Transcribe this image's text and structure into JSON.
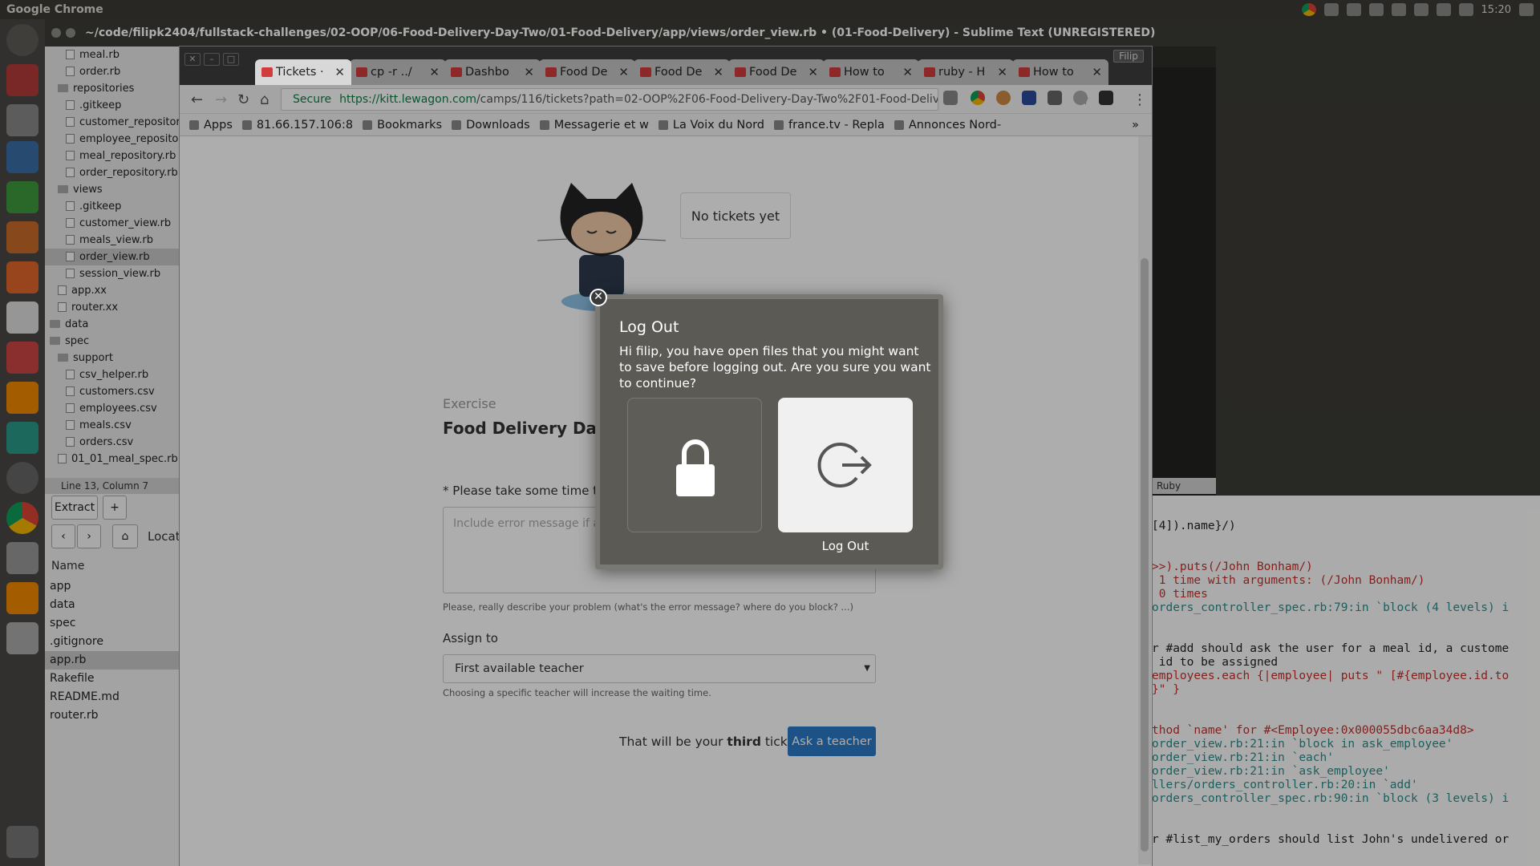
{
  "topbar": {
    "app_name": "Google Chrome",
    "time": "15:20"
  },
  "sublime": {
    "title": "~/code/filipk2404/fullstack-challenges/02-OOP/06-Food-Delivery-Day-Two/01-Food-Delivery/app/views/order_view.rb • (01-Food-Delivery) - Sublime Text (UNREGISTERED)",
    "status": "Line 13, Column 7",
    "right_status": "Ruby",
    "sidebar": [
      {
        "label": "meal.rb",
        "type": "file",
        "indent": 2
      },
      {
        "label": "order.rb",
        "type": "file",
        "indent": 2
      },
      {
        "label": "repositories",
        "type": "folder",
        "indent": 1
      },
      {
        "label": ".gitkeep",
        "type": "file",
        "indent": 2
      },
      {
        "label": "customer_repository.rb",
        "type": "file",
        "indent": 2
      },
      {
        "label": "employee_repository.rb",
        "type": "file",
        "indent": 2
      },
      {
        "label": "meal_repository.rb",
        "type": "file",
        "indent": 2
      },
      {
        "label": "order_repository.rb",
        "type": "file",
        "indent": 2
      },
      {
        "label": "views",
        "type": "folder",
        "indent": 1
      },
      {
        "label": ".gitkeep",
        "type": "file",
        "indent": 2
      },
      {
        "label": "customer_view.rb",
        "type": "file",
        "indent": 2
      },
      {
        "label": "meals_view.rb",
        "type": "file",
        "indent": 2
      },
      {
        "label": "order_view.rb",
        "type": "file",
        "indent": 2,
        "selected": true
      },
      {
        "label": "session_view.rb",
        "type": "file",
        "indent": 2
      },
      {
        "label": "app.xx",
        "type": "file",
        "indent": 1
      },
      {
        "label": "router.xx",
        "type": "file",
        "indent": 1
      },
      {
        "label": "data",
        "type": "folder",
        "indent": 0
      },
      {
        "label": "spec",
        "type": "folder",
        "indent": 0
      },
      {
        "label": "support",
        "type": "folder",
        "indent": 1
      },
      {
        "label": "csv_helper.rb",
        "type": "file",
        "indent": 2
      },
      {
        "label": "customers.csv",
        "type": "file",
        "indent": 2
      },
      {
        "label": "employees.csv",
        "type": "file",
        "indent": 2
      },
      {
        "label": "meals.csv",
        "type": "file",
        "indent": 2
      },
      {
        "label": "orders.csv",
        "type": "file",
        "indent": 2
      },
      {
        "label": "01_01_meal_spec.rb",
        "type": "file",
        "indent": 1
      }
    ]
  },
  "filemanager": {
    "extract_label": "Extract",
    "plus_label": "+",
    "location_label": "Locat",
    "name_header": "Name",
    "items": [
      "app",
      "data",
      "spec",
      ".gitignore",
      "app.rb",
      "Rakefile",
      "README.md",
      "router.rb"
    ],
    "selected": "app.rb"
  },
  "terminal": {
    "lines": [
      {
        "text": "[4]).name}/)",
        "cls": ""
      },
      {
        "text": "",
        "cls": "gap"
      },
      {
        "text": ">>).puts(/John Bonham/)",
        "cls": "red"
      },
      {
        "text": " 1 time with arguments: (/John Bonham/)",
        "cls": "red"
      },
      {
        "text": " 0 times",
        "cls": "red"
      },
      {
        "text": "orders_controller_spec.rb:79:in `block (4 levels) i",
        "cls": "cyan"
      },
      {
        "text": "",
        "cls": "gap"
      },
      {
        "text": "r #add should ask the user for a meal id, a custome",
        "cls": ""
      },
      {
        "text": " id to be assigned",
        "cls": ""
      },
      {
        "text": "employees.each {|employee| puts \" [#{employee.id.to",
        "cls": "red"
      },
      {
        "text": "}\" }",
        "cls": "red"
      },
      {
        "text": "",
        "cls": "gap"
      },
      {
        "text": "thod `name' for #<Employee:0x000055dbc6aa34d8>",
        "cls": "red"
      },
      {
        "text": "order_view.rb:21:in `block in ask_employee'",
        "cls": "cyan"
      },
      {
        "text": "order_view.rb:21:in `each'",
        "cls": "cyan"
      },
      {
        "text": "order_view.rb:21:in `ask_employee'",
        "cls": "cyan"
      },
      {
        "text": "llers/orders_controller.rb:20:in `add'",
        "cls": "cyan"
      },
      {
        "text": "orders_controller_spec.rb:90:in `block (3 levels) i",
        "cls": "cyan"
      },
      {
        "text": "",
        "cls": "gap"
      },
      {
        "text": "r #list_my_orders should list John's undelivered or",
        "cls": ""
      }
    ]
  },
  "chrome": {
    "profile": "Filip",
    "tabs": [
      {
        "label": "Tickets ·",
        "active": true
      },
      {
        "label": "cp -r ../",
        "active": false
      },
      {
        "label": "Dashbo",
        "active": false
      },
      {
        "label": "Food De",
        "active": false
      },
      {
        "label": "Food De",
        "active": false
      },
      {
        "label": "Food De",
        "active": false
      },
      {
        "label": "How to",
        "active": false
      },
      {
        "label": "ruby - H",
        "active": false
      },
      {
        "label": "How to",
        "active": false
      }
    ],
    "secure_label": "Secure",
    "url_host": "https://kitt.lewagon.com",
    "url_rest": "/camps/116/tickets?path=02-OOP%2F06-Food-Delivery-Day-Two%2F01-Food-Deliv...",
    "bookmarks": [
      "Apps",
      "81.66.157.106:8",
      "Bookmarks",
      "Downloads",
      "Messagerie et w",
      "La Voix du Nord",
      "france.tv - Repla",
      "Annonces Nord-"
    ],
    "more_bookmarks": "»"
  },
  "page": {
    "bubble": "No tickets yet",
    "exercise_label": "Exercise",
    "exercise_title": "Food Delivery Day 2",
    "required_mark": "*",
    "request_label": "Please take some time to describe your problem",
    "textarea_placeholder": "Include error message if any",
    "help_description": "Please, really describe your problem (what's the error message? where do you block? ...)",
    "assign_label": "Assign to",
    "assign_value": "First available teacher",
    "help_assign": "Choosing a specific teacher will increase the waiting time.",
    "ticket_prefix": "That will be your",
    "ticket_count": "third",
    "ticket_suffix": "ticket",
    "ask_button": "Ask a teacher"
  },
  "dialog": {
    "title": "Log Out",
    "message": "Hi filip, you have open files that you might want to save before logging out. Are you sure you want to continue?",
    "logout_label": "Log Out",
    "close_glyph": "✕"
  }
}
